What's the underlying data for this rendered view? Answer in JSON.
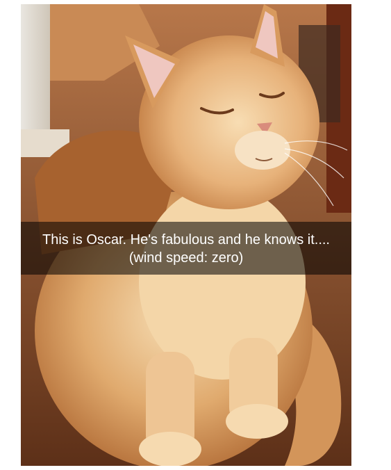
{
  "snap": {
    "caption_line1": "This is Oscar. He's fabulous and he knows it....",
    "caption_line2": "(wind speed: zero)"
  },
  "subject": "orange-long-haired-cat",
  "colors": {
    "fur_light": "#f3d2a4",
    "fur_mid": "#d59a5e",
    "fur_dark": "#a55f2d",
    "floor": "#8a5532",
    "wall": "#e8e2d8",
    "caption_bg": "#000000"
  }
}
